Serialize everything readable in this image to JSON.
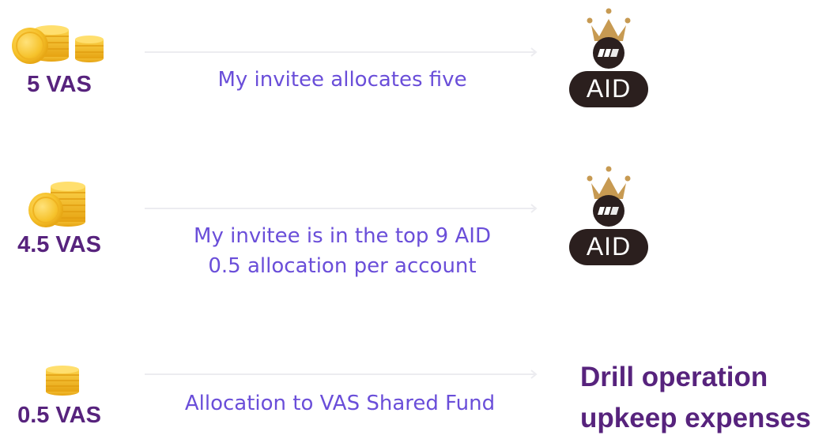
{
  "rows": [
    {
      "amount": "5 VAS",
      "description": [
        "My invitee allocates five"
      ],
      "target_badge": "AID"
    },
    {
      "amount": "4.5 VAS",
      "description": [
        "My invitee is in the top 9 AID",
        "0.5 allocation per account"
      ],
      "target_badge": "AID"
    },
    {
      "amount": "0.5 VAS",
      "description": [
        "Allocation to VAS Shared Fund"
      ],
      "target_text": [
        "Drill operation",
        "upkeep expenses"
      ]
    }
  ],
  "colors": {
    "amount_text": "#57237d",
    "description_text": "#6a4ed9",
    "coin_gold": "#f6c22b",
    "badge_dark": "#2b1f1e",
    "crown_gold": "#c79a52",
    "arrow_line": "#ececf0"
  }
}
